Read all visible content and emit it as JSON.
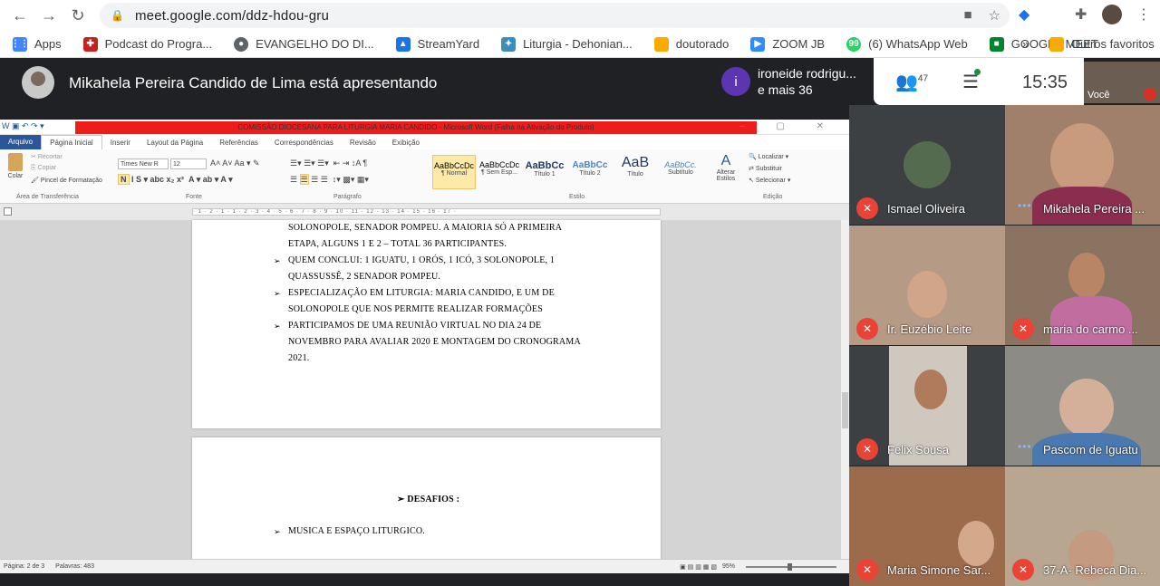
{
  "browser": {
    "url": "meet.google.com/ddz-hdou-gru",
    "bookmarks": [
      {
        "label": "Apps",
        "color": "#4285f4"
      },
      {
        "label": "Podcast do Progra...",
        "color": "#c5221f"
      },
      {
        "label": "EVANGELHO DO DI...",
        "color": "#5f6368"
      },
      {
        "label": "StreamYard",
        "color": "#1a73e8"
      },
      {
        "label": "Liturgia - Dehonian...",
        "color": "#3c8dbc"
      },
      {
        "label": "doutorado",
        "color": "#f9ab00"
      },
      {
        "label": "ZOOM JB",
        "color": "#2d8cff"
      },
      {
        "label": "(6) WhatsApp Web",
        "color": "#25d366"
      },
      {
        "label": "GOOGLE MEET",
        "color": "#00832d"
      }
    ],
    "more": "»",
    "other_favorites": "Outros favoritos"
  },
  "meet": {
    "presenter_text": "Mikahela Pereira Candido de Lima está apresentando",
    "notification": {
      "initial": "i",
      "line1": "ironeide rodrigu...",
      "line2": "e mais 36"
    },
    "people_count": "47",
    "clock": "15:35",
    "self_label": "Você"
  },
  "word": {
    "title": "COMISSÃO DIOCESANA PARA LITURGIA MARIA CANDIDO  -  Microsoft Word (Falha na Ativação do Produto)",
    "tabs": [
      "Arquivo",
      "Página Inicial",
      "Inserir",
      "Layout da Página",
      "Referências",
      "Correspondências",
      "Revisão",
      "Exibição"
    ],
    "clipboard": {
      "colar": "Colar",
      "recortar": "Recortar",
      "copiar": "Copiar",
      "pincel": "Pincel de Formatação",
      "label": "Área de Transferência"
    },
    "font": {
      "name": "Times New R",
      "size": "12",
      "label": "Fonte"
    },
    "paragraph_label": "Parágrafo",
    "styles": [
      {
        "sample": "AaBbCcDc",
        "name": "¶ Normal"
      },
      {
        "sample": "AaBbCcDc",
        "name": "¶ Sem Esp..."
      },
      {
        "sample": "AaBbCc",
        "name": "Título 1"
      },
      {
        "sample": "AaBbCc",
        "name": "Título 2"
      },
      {
        "sample": "AaB",
        "name": "Título"
      },
      {
        "sample": "AaBbCc.",
        "name": "Subtítulo"
      }
    ],
    "style_label": "Estilo",
    "alterar_estilos": "Alterar Estilos",
    "editing": {
      "localizar": "Localizar",
      "substituir": "Substituir",
      "selecionar": "Selecionar",
      "label": "Edição"
    },
    "page1_lines": [
      "SOLONOPOLE, SENADOR POMPEU. A MAIORIA SÓ A PRIMEIRA",
      "ETAPA, ALGUNS 1 E 2 – TOTAL 36 PARTICIPANTES.",
      "QUEM CONCLUI: 1 IGUATU, 1 ORÓS, 1 ICÓ, 3 SOLONOPOLE, 1",
      "QUASSUSSÊ, 2 SENADOR POMPEU.",
      "ESPECIALIZAÇÃO EM LITURGIA: MARIA CANDIDO, E UM DE",
      "SOLONOPOLE QUE NOS PERMITE REALIZAR FORMAÇÕES",
      "PARTICIPAMOS DE UMA REUNIÃO VIRTUAL NO DIA 24 DE",
      "NOVEMBRO PARA AVALIAR 2020 E MONTAGEM DO CRONOGRAMA",
      "2021."
    ],
    "page2_heading": "DESAFIOS :",
    "page2_item": "MUSICA  E ESPAÇO LITURGICO.",
    "status": {
      "page": "Página: 2 de 3",
      "words": "Palavras: 483",
      "zoom": "95%"
    }
  },
  "participants": [
    {
      "name": "Ismael Oliveira",
      "state": "muted",
      "bg": "#3c4043"
    },
    {
      "name": "Mikahela Pereira ...",
      "state": "speaking",
      "bg": "#a0806a"
    },
    {
      "name": "Ir. Euzébio Leite",
      "state": "muted",
      "bg": "#b59a86"
    },
    {
      "name": "maria do carmo ...",
      "state": "muted",
      "bg": "#8a7360"
    },
    {
      "name": "Felix Sousa",
      "state": "muted",
      "bg": "#3c4043"
    },
    {
      "name": "Pascom de Iguatu",
      "state": "speaking",
      "bg": "#8c8b86"
    },
    {
      "name": "Maria Simone Sar...",
      "state": "muted",
      "bg": "#9b6b4c"
    },
    {
      "name": "37-A- Rebeca Dia...",
      "state": "muted",
      "bg": "#b8a690"
    }
  ]
}
